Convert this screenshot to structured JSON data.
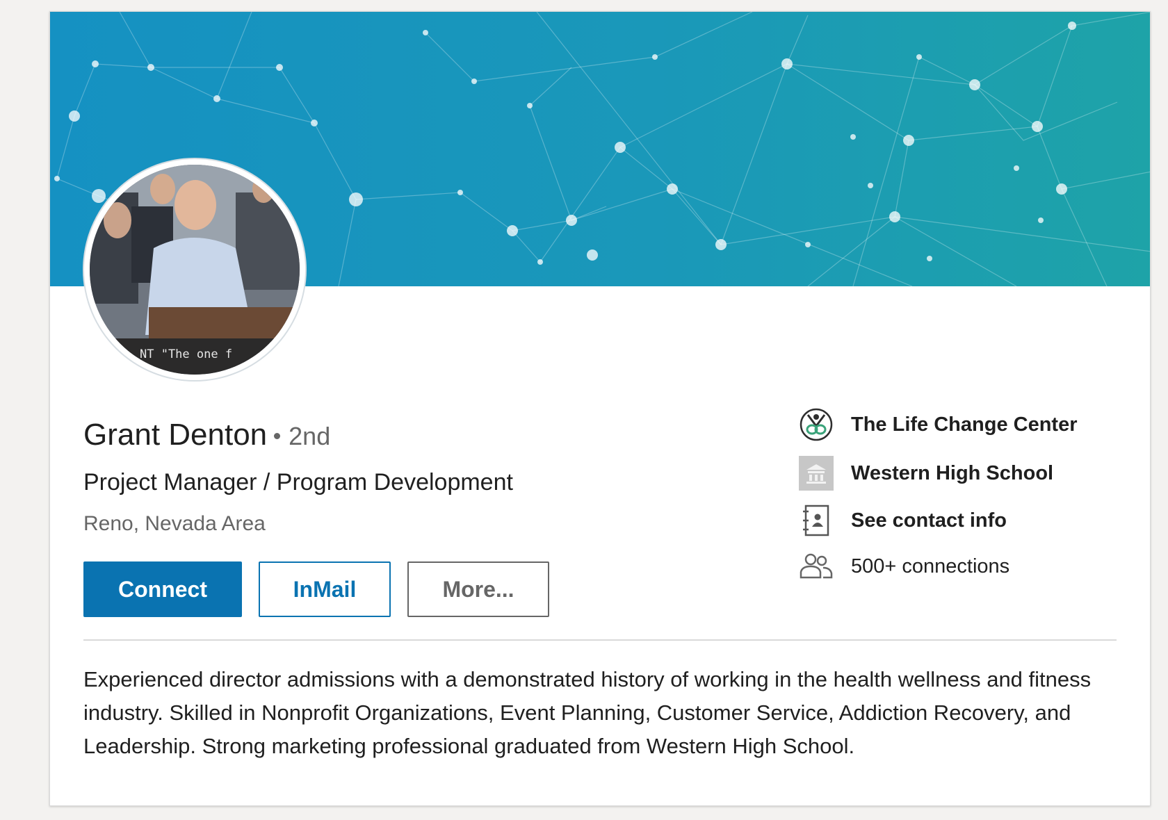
{
  "profile": {
    "name": "Grant Denton",
    "degree": "2nd",
    "headline": "Project Manager / Program Development",
    "location": "Reno, Nevada Area",
    "avatar_caption": "NT \"The one f"
  },
  "actions": {
    "connect_label": "Connect",
    "inmail_label": "InMail",
    "more_label": "More..."
  },
  "sidebar": {
    "company": "The Life Change Center",
    "school": "Western High School",
    "contact": "See contact info",
    "connections": "500+ connections"
  },
  "summary": "Experienced director admissions with a demonstrated history of working in the health wellness and fitness industry. Skilled in Nonprofit Organizations, Event Planning, Customer Service, Addiction Recovery, and Leadership. Strong marketing professional graduated from Western High School.",
  "colors": {
    "brand_blue": "#0a73b1",
    "banner_start": "#1591c2",
    "banner_end": "#1ea3a8"
  },
  "icons": {
    "company": "life-change-center-logo",
    "school": "school-building-icon",
    "contact": "contact-card-icon",
    "connections": "people-icon"
  }
}
